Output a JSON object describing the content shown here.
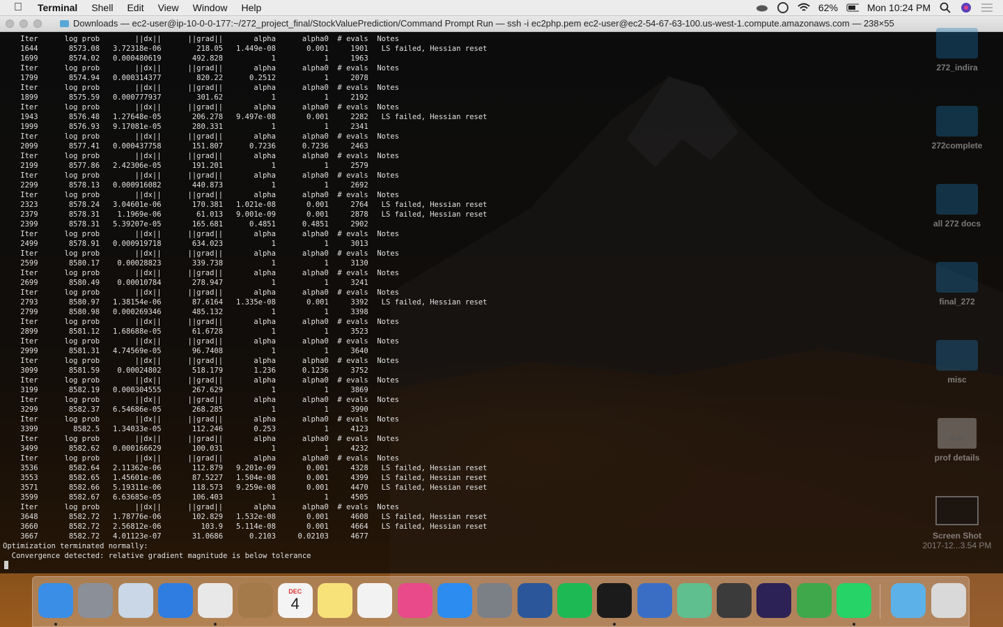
{
  "menubar": {
    "apple_icon": "apple-icon",
    "app_name": "Terminal",
    "menus": [
      "Shell",
      "Edit",
      "View",
      "Window",
      "Help"
    ],
    "battery": "62%",
    "clock": "Mon 10:24 PM"
  },
  "window": {
    "title": "Downloads — ec2-user@ip-10-0-0-177:~/272_project_final/StockValuePrediction/Command Prompt Run — ssh -i ec2php.pem ec2-user@ec2-54-67-63-100.us-west-1.compute.amazonaws.com — 238×55"
  },
  "terminal": {
    "lines": [
      "    Iter      log prob        ||dx||      ||grad||       alpha      alpha0  # evals  Notes",
      "    1644       8573.08   3.72318e-06        218.05   1.449e-08       0.001     1901   LS failed, Hessian reset",
      "    1699       8574.02   0.000480619       492.828           1           1     1963",
      "    Iter      log prob        ||dx||      ||grad||       alpha      alpha0  # evals  Notes",
      "    1799       8574.94   0.000314377        820.22      0.2512           1     2078",
      "    Iter      log prob        ||dx||      ||grad||       alpha      alpha0  # evals  Notes",
      "    1899       8575.59   0.000777937        301.62           1           1     2192",
      "    Iter      log prob        ||dx||      ||grad||       alpha      alpha0  # evals  Notes",
      "    1943       8576.48   1.27648e-05       206.278   9.497e-08       0.001     2282   LS failed, Hessian reset",
      "    1999       8576.93   9.17081e-05       280.331           1           1     2341",
      "    Iter      log prob        ||dx||      ||grad||       alpha      alpha0  # evals  Notes",
      "    2099       8577.41   0.000437758       151.807      0.7236      0.7236     2463",
      "    Iter      log prob        ||dx||      ||grad||       alpha      alpha0  # evals  Notes",
      "    2199       8577.86   2.42306e-05       191.201           1           1     2579",
      "    Iter      log prob        ||dx||      ||grad||       alpha      alpha0  # evals  Notes",
      "    2299       8578.13   0.000916082       440.873           1           1     2692",
      "    Iter      log prob        ||dx||      ||grad||       alpha      alpha0  # evals  Notes",
      "    2323       8578.24   3.04601e-06       170.381   1.021e-08       0.001     2764   LS failed, Hessian reset",
      "    2379       8578.31    1.1969e-06        61.013   9.001e-09       0.001     2878   LS failed, Hessian reset",
      "    2399       8578.31   5.39207e-05       165.681      0.4851      0.4851     2902",
      "    Iter      log prob        ||dx||      ||grad||       alpha      alpha0  # evals  Notes",
      "    2499       8578.91   0.000919718       634.023           1           1     3013",
      "    Iter      log prob        ||dx||      ||grad||       alpha      alpha0  # evals  Notes",
      "    2599       8580.17    0.00028823       339.738           1           1     3130",
      "    Iter      log prob        ||dx||      ||grad||       alpha      alpha0  # evals  Notes",
      "    2699       8580.49    0.00010784       278.947           1           1     3241",
      "    Iter      log prob        ||dx||      ||grad||       alpha      alpha0  # evals  Notes",
      "    2793       8580.97   1.38154e-06       87.6164   1.335e-08       0.001     3392   LS failed, Hessian reset",
      "    2799       8580.98   0.000269346       485.132           1           1     3398",
      "    Iter      log prob        ||dx||      ||grad||       alpha      alpha0  # evals  Notes",
      "    2899       8581.12   1.68688e-05       61.6728           1           1     3523",
      "    Iter      log prob        ||dx||      ||grad||       alpha      alpha0  # evals  Notes",
      "    2999       8581.31   4.74569e-05       96.7408           1           1     3640",
      "    Iter      log prob        ||dx||      ||grad||       alpha      alpha0  # evals  Notes",
      "    3099       8581.59    0.00024802       518.179       1.236      0.1236     3752",
      "    Iter      log prob        ||dx||      ||grad||       alpha      alpha0  # evals  Notes",
      "    3199       8582.19   0.000304555       267.629           1           1     3869",
      "    Iter      log prob        ||dx||      ||grad||       alpha      alpha0  # evals  Notes",
      "    3299       8582.37   6.54686e-05       268.285           1           1     3990",
      "    Iter      log prob        ||dx||      ||grad||       alpha      alpha0  # evals  Notes",
      "    3399        8582.5   1.34033e-05       112.246       0.253           1     4123",
      "    Iter      log prob        ||dx||      ||grad||       alpha      alpha0  # evals  Notes",
      "    3499       8582.62   0.000166629       100.031           1           1     4232",
      "    Iter      log prob        ||dx||      ||grad||       alpha      alpha0  # evals  Notes",
      "    3536       8582.64   2.11362e-06       112.879   9.201e-09       0.001     4328   LS failed, Hessian reset",
      "    3553       8582.65   1.45601e-06       87.5227   1.504e-08       0.001     4399   LS failed, Hessian reset",
      "    3571       8582.66   5.19311e-06       118.573   9.259e-08       0.001     4470   LS failed, Hessian reset",
      "    3599       8582.67   6.63685e-05       106.403           1           1     4505",
      "    Iter      log prob        ||dx||      ||grad||       alpha      alpha0  # evals  Notes",
      "    3648       8582.72   1.78776e-06       102.829   1.532e-08       0.001     4608   LS failed, Hessian reset",
      "    3660       8582.72   2.56812e-06         103.9   5.114e-08       0.001     4664   LS failed, Hessian reset",
      "    3667       8582.72   4.01123e-07       31.0686      0.2103     0.02103     4677",
      "Optimization terminated normally:",
      "  Convergence detected: relative gradient magnitude is below tolerance"
    ]
  },
  "desktop": {
    "icons": [
      {
        "label": "272_indira",
        "kind": "folder"
      },
      {
        "label": "272complete",
        "kind": "folder"
      },
      {
        "label": "all 272 docs",
        "kind": "folder"
      },
      {
        "label": "final_272",
        "kind": "folder"
      },
      {
        "label": "misc",
        "kind": "folder"
      },
      {
        "label": "prof details",
        "kind": "xlsx",
        "badge": "XLSX"
      },
      {
        "label": "Screen Shot",
        "sublabel": "2017-12...3.54 PM",
        "kind": "screenshot"
      }
    ]
  },
  "dock": {
    "apps": [
      {
        "name": "finder-icon",
        "color": "#3a8ee6"
      },
      {
        "name": "launchpad-icon",
        "color": "#8a8f98"
      },
      {
        "name": "mail-icon",
        "color": "#c9d7e6"
      },
      {
        "name": "safari-icon",
        "color": "#2f7de1"
      },
      {
        "name": "chrome-icon",
        "color": "#e8e8e8"
      },
      {
        "name": "contacts-icon",
        "color": "#a47a4a"
      },
      {
        "name": "calendar-icon",
        "color": "#f4f4f4",
        "month": "DEC",
        "day": "4"
      },
      {
        "name": "notes-icon",
        "color": "#f7e27a"
      },
      {
        "name": "photos-icon",
        "color": "#f2f2f2"
      },
      {
        "name": "itunes-icon",
        "color": "#e84a8a"
      },
      {
        "name": "app-store-icon",
        "color": "#2d8cf0"
      },
      {
        "name": "system-preferences-icon",
        "color": "#7b7f86"
      },
      {
        "name": "word-icon",
        "color": "#2b579a"
      },
      {
        "name": "spotify-icon",
        "color": "#1db954"
      },
      {
        "name": "terminal-icon",
        "color": "#1b1b1b"
      },
      {
        "name": "virtualbox-icon",
        "color": "#3a6ec4"
      },
      {
        "name": "atom-icon",
        "color": "#5fbf8f"
      },
      {
        "name": "sublime-icon",
        "color": "#3b3b3b"
      },
      {
        "name": "eclipse-icon",
        "color": "#2c2255"
      },
      {
        "name": "sourcetree-icon",
        "color": "#3ea84a"
      },
      {
        "name": "whatsapp-icon",
        "color": "#25d366"
      },
      {
        "name": "downloads-folder-icon",
        "color": "#5cb2e8"
      },
      {
        "name": "trash-icon",
        "color": "#d9d9d9"
      }
    ]
  }
}
